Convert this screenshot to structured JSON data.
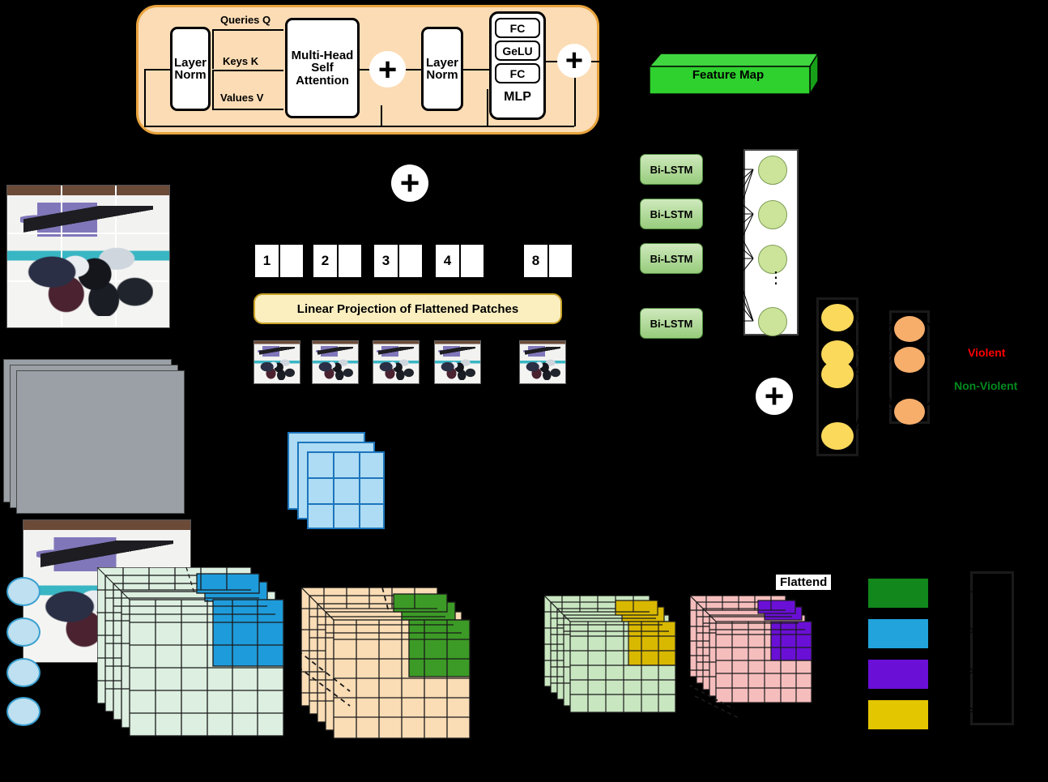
{
  "title": "Violence detection architecture: ViT encoder + CNN + Bi-LSTM",
  "encoder": {
    "layer_norm_1": "Layer\nNorm",
    "layer_norm_1_line1": "Layer",
    "layer_norm_1_line2": "Norm",
    "layer_norm_2_line1": "Layer",
    "layer_norm_2_line2": "Norm",
    "attention_line1": "Multi-Head",
    "attention_line2": "Self",
    "attention_line3": "Attention",
    "queries_label": "Queries Q",
    "keys_label": "Keys K",
    "values_label": "Values V",
    "mlp": {
      "fc1": "FC",
      "gelu": "GeLU",
      "fc2": "FC",
      "name": "MLP"
    },
    "add_symbol": "+",
    "panel_bg": "#FBDCB5",
    "panel_border": "#E8A33D"
  },
  "feature_map": {
    "label": "Feature Map",
    "color": "#2ED12E",
    "top_color": "#3FD63F",
    "side_color": "#1BA81B"
  },
  "patch_embedding": {
    "tokens": [
      "1",
      "2",
      "3",
      "4",
      "8"
    ],
    "linear_projection_label": "Linear Projection of Flattened Patches",
    "projection_bg": "#FBEFC0",
    "projection_border": "#C9A227",
    "add_symbol": "+"
  },
  "recurrent": {
    "bilstm_label": "Bi-LSTM",
    "bilstm_count": 4,
    "bilstm_color": "#97CC7C",
    "dense_nodes": 4,
    "dense_node_color": "#CBE49A",
    "ellipsis": "⋮"
  },
  "classifier": {
    "fuse_symbol": "+",
    "yellow_nodes": 4,
    "yellow_color": "#FBD95B",
    "orange_nodes": 3,
    "orange_color": "#F7AE6B",
    "classes": [
      {
        "label": "Violent",
        "color": "#FF0000"
      },
      {
        "label": "Non-Violent",
        "color": "#008A1E"
      }
    ]
  },
  "cnn": {
    "flatten_label": "Flattend",
    "stacks": [
      {
        "name": "conv-stack-1",
        "base": "#DCEFE0",
        "highlight": "#1E9BDA"
      },
      {
        "name": "conv-stack-2",
        "base": "#FADCB5",
        "highlight": "#3C9B26"
      },
      {
        "name": "conv-stack-3",
        "base": "#C8E6C0",
        "highlight": "#D9B800"
      },
      {
        "name": "conv-stack-4",
        "base": "#F6BDBD",
        "highlight": "#6A0FD6"
      }
    ],
    "bars": [
      {
        "name": "bar-green",
        "color": "#11871C"
      },
      {
        "name": "bar-blue",
        "color": "#22A3DC"
      },
      {
        "name": "bar-purple",
        "color": "#6A0FD6"
      },
      {
        "name": "bar-yellow",
        "color": "#E3C500"
      }
    ],
    "output_nodes": 4,
    "output_node_color": "#BEE0F0"
  },
  "media": {
    "grid_frame_caption": "hockey-fight-frame-with-patch-grid",
    "stacked_frames_caption": "hockey-fight-video-frame-stack",
    "patch_count": 5
  }
}
